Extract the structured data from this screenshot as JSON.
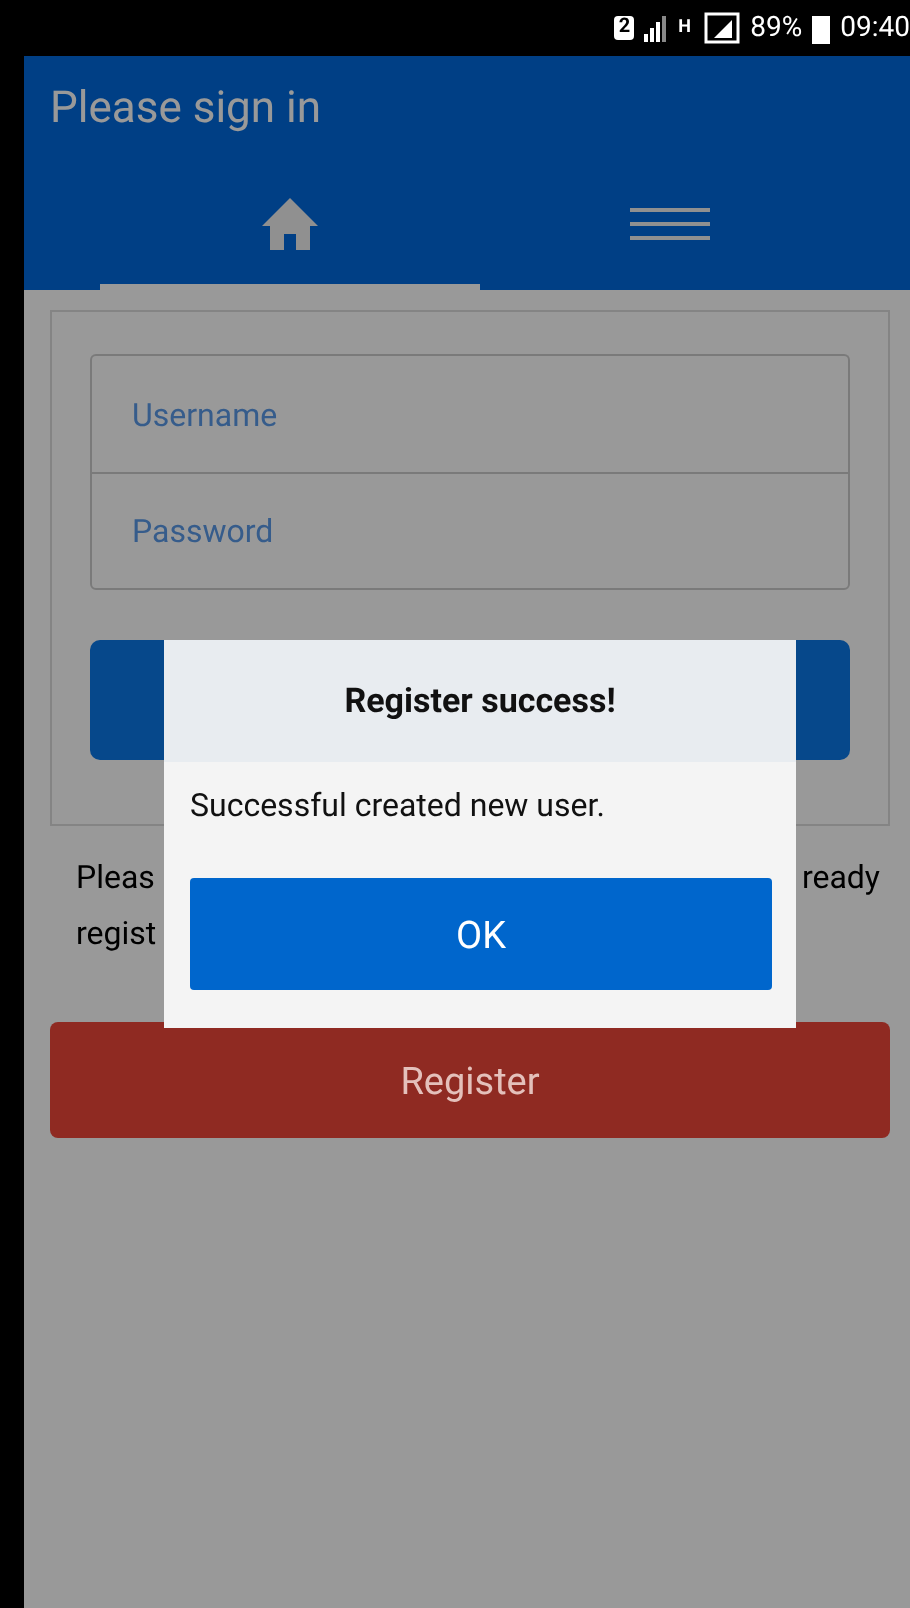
{
  "status_bar": {
    "sim": "2",
    "network": "H",
    "battery": "89%",
    "time": "09:40"
  },
  "header": {
    "title": "Please sign in"
  },
  "tabs": [
    {
      "kind": "home",
      "selected": true
    },
    {
      "kind": "menu",
      "selected": false
    }
  ],
  "login": {
    "username": {
      "placeholder": "Username"
    },
    "password": {
      "placeholder": "Password"
    }
  },
  "hint": {
    "line_1_start": "Pleas",
    "line_1_end": "ready",
    "line_2_start": "regist"
  },
  "register_button": "Register",
  "dialog": {
    "title": "Register success!",
    "message": "Successful created new user.",
    "button": "OK"
  }
}
